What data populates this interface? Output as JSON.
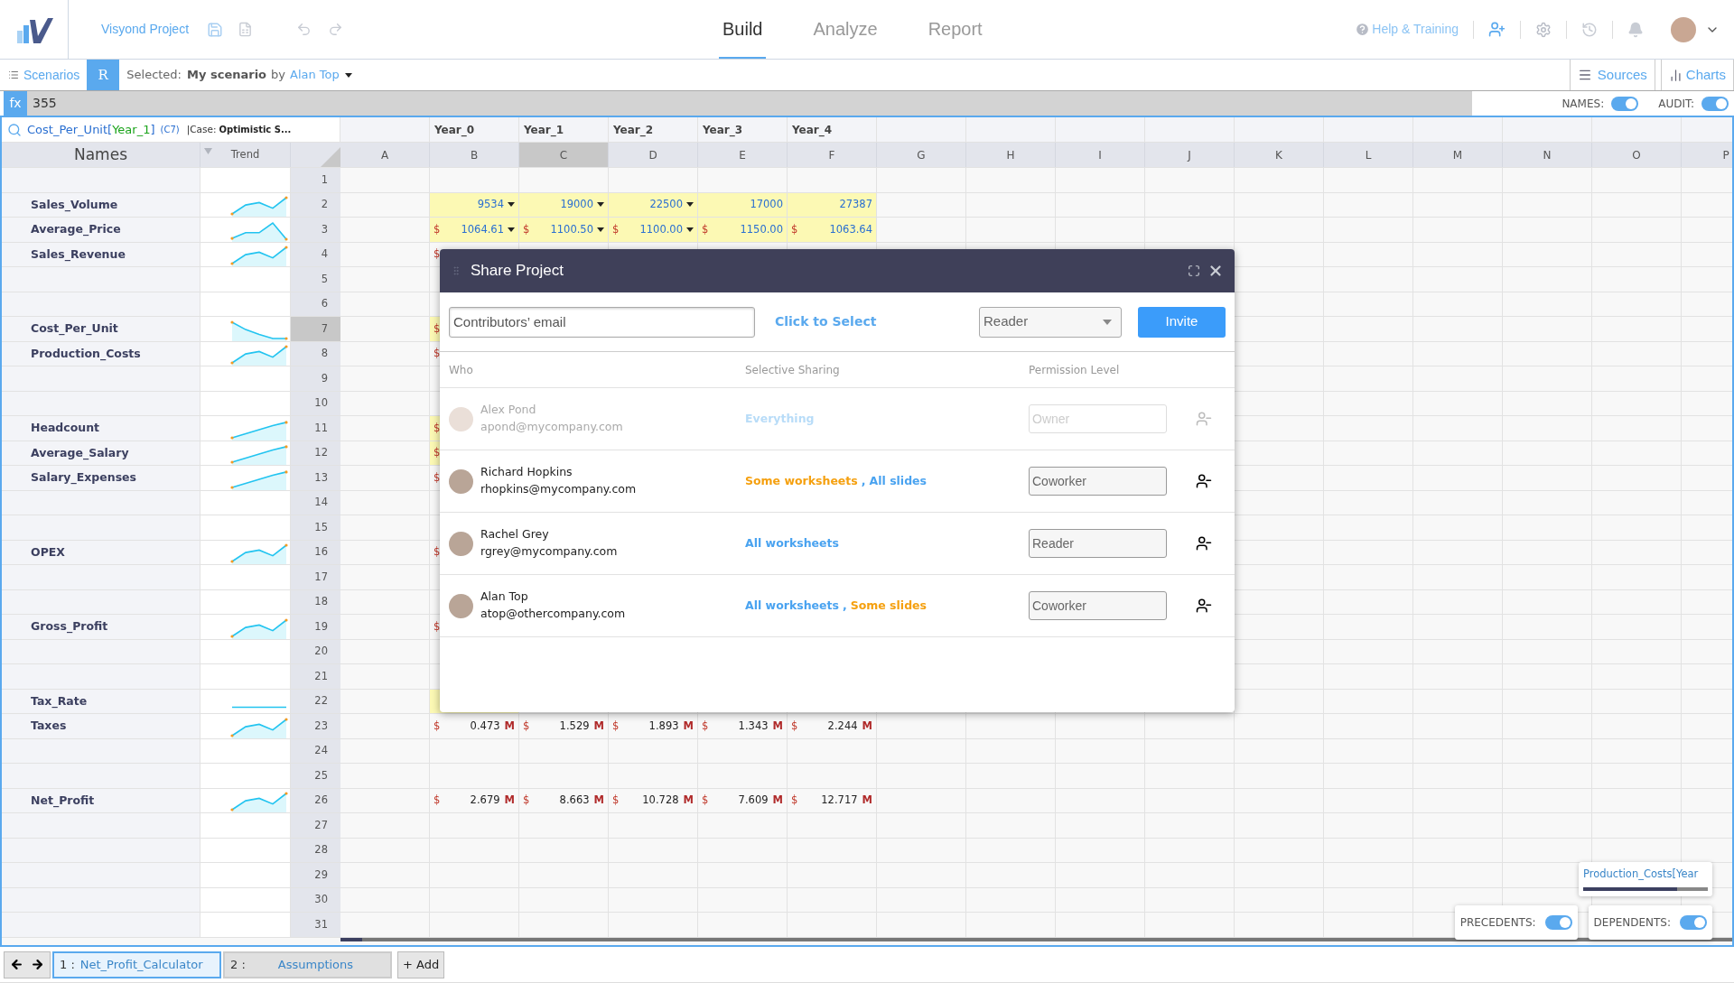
{
  "header": {
    "project": "Visyond Project",
    "tabs": [
      {
        "label": "Build",
        "selected": true
      },
      {
        "label": "Analyze",
        "selected": false
      },
      {
        "label": "Report",
        "selected": false
      }
    ],
    "help": "Help & Training"
  },
  "scenario_bar": {
    "scenarios": "Scenarios",
    "badge": "R",
    "label": "Selected:",
    "scenario": "My scenario",
    "by": "by",
    "owner": "Alan Top",
    "sources": "Sources",
    "charts": "Charts"
  },
  "formula_bar": {
    "fx": "fx",
    "value": "355",
    "toggles": [
      {
        "label": "NAMES:",
        "on": true
      },
      {
        "label": "AUDIT:",
        "on": true
      }
    ]
  },
  "name_box": {
    "parts": [
      {
        "text": "Cost_Per_Unit[",
        "kind": "name"
      },
      {
        "text": "Year_1",
        "kind": "index"
      },
      {
        "text": "]",
        "kind": "name"
      }
    ],
    "cell": "(C7)",
    "case_label": "|Case:",
    "case": "Optimistic S..."
  },
  "sheet": {
    "names_header": "Names",
    "trend_header": "Trend",
    "year_labels": [
      "Year_0",
      "Year_1",
      "Year_2",
      "Year_3",
      "Year_4"
    ],
    "columns": [
      {
        "letter": "A",
        "selected": false
      },
      {
        "letter": "B",
        "selected": false
      },
      {
        "letter": "C",
        "selected": true
      },
      {
        "letter": "D",
        "selected": false
      },
      {
        "letter": "E",
        "selected": false
      },
      {
        "letter": "F",
        "selected": false
      },
      {
        "letter": "G",
        "selected": false
      },
      {
        "letter": "H",
        "selected": false
      },
      {
        "letter": "I",
        "selected": false
      },
      {
        "letter": "J",
        "selected": false
      },
      {
        "letter": "K",
        "selected": false
      },
      {
        "letter": "L",
        "selected": false
      },
      {
        "letter": "M",
        "selected": false
      },
      {
        "letter": "N",
        "selected": false
      },
      {
        "letter": "O",
        "selected": false
      },
      {
        "letter": "P",
        "selected": false
      }
    ],
    "rows": [
      {
        "number": "1",
        "selected": false,
        "kind": "blank"
      },
      {
        "number": "2",
        "selected": false,
        "name": "Sales_Volume",
        "kind": "wave",
        "cells": [
          {
            "value": "9534",
            "input": true,
            "dropdown": true
          },
          {
            "value": "19000",
            "input": true,
            "dropdown": true
          },
          {
            "value": "22500",
            "input": true,
            "dropdown": true
          },
          {
            "value": "17000",
            "input": true,
            "dropdown": false
          },
          {
            "value": "27387",
            "input": true,
            "dropdown": false
          }
        ]
      },
      {
        "number": "3",
        "selected": false,
        "name": "Average_Price",
        "kind": "peak",
        "cells": [
          {
            "currency": "$",
            "value": "1064.61",
            "input": true,
            "dropdown": true
          },
          {
            "currency": "$",
            "value": "1100.50",
            "input": true,
            "dropdown": true
          },
          {
            "currency": "$",
            "value": "1100.00",
            "input": true,
            "dropdown": true
          },
          {
            "currency": "$",
            "value": "1150.00",
            "input": true,
            "dropdown": false
          },
          {
            "currency": "$",
            "value": "1063.64",
            "input": true,
            "dropdown": false
          }
        ]
      },
      {
        "number": "4",
        "selected": false,
        "name": "Sales_Revenue",
        "kind": "wave",
        "cells": [
          {
            "currency": "$",
            "input": false
          }
        ]
      },
      {
        "number": "5",
        "selected": false,
        "kind": "blank"
      },
      {
        "number": "6",
        "selected": false,
        "kind": "blank"
      },
      {
        "number": "7",
        "selected": true,
        "name": "Cost_Per_Unit",
        "kind": "fall",
        "cells": [
          {
            "currency": "$",
            "input": true
          }
        ]
      },
      {
        "number": "8",
        "selected": false,
        "name": "Production_Costs",
        "kind": "wave",
        "cells": [
          {
            "currency": "$",
            "input": false
          }
        ]
      },
      {
        "number": "9",
        "selected": false,
        "kind": "blank"
      },
      {
        "number": "10",
        "selected": false,
        "kind": "blank"
      },
      {
        "number": "11",
        "selected": false,
        "name": "Headcount",
        "kind": "rise",
        "cells": [
          {
            "currency": "$",
            "input": true
          }
        ]
      },
      {
        "number": "12",
        "selected": false,
        "name": "Average_Salary",
        "kind": "rise",
        "cells": [
          {
            "currency": "$",
            "input": true
          }
        ]
      },
      {
        "number": "13",
        "selected": false,
        "name": "Salary_Expenses",
        "kind": "rise",
        "cells": [
          {
            "currency": "$",
            "input": false
          }
        ]
      },
      {
        "number": "14",
        "selected": false,
        "kind": "blank"
      },
      {
        "number": "15",
        "selected": false,
        "kind": "blank"
      },
      {
        "number": "16",
        "selected": false,
        "name": "OPEX",
        "kind": "wave",
        "cells": [
          {
            "currency": "$",
            "input": false
          }
        ]
      },
      {
        "number": "17",
        "selected": false,
        "kind": "blank"
      },
      {
        "number": "18",
        "selected": false,
        "kind": "blank"
      },
      {
        "number": "19",
        "selected": false,
        "name": "Gross_Profit",
        "kind": "wave",
        "cells": [
          {
            "currency": "$",
            "input": false
          }
        ]
      },
      {
        "number": "20",
        "selected": false,
        "kind": "blank"
      },
      {
        "number": "21",
        "selected": false,
        "kind": "blank"
      },
      {
        "number": "22",
        "selected": false,
        "name": "Tax_Rate",
        "kind": "flat",
        "cells": [
          {
            "input": true
          }
        ]
      },
      {
        "number": "23",
        "selected": false,
        "name": "Taxes",
        "kind": "wave",
        "cells": [
          {
            "currency": "$",
            "value": "0.473",
            "unit": "M",
            "input": false,
            "dropdown": false
          },
          {
            "currency": "$",
            "value": "1.529",
            "unit": "M",
            "input": false,
            "dropdown": false
          },
          {
            "currency": "$",
            "value": "1.893",
            "unit": "M",
            "input": false,
            "dropdown": false
          },
          {
            "currency": "$",
            "value": "1.343",
            "unit": "M",
            "input": false,
            "dropdown": false
          },
          {
            "currency": "$",
            "value": "2.244",
            "unit": "M",
            "input": false,
            "dropdown": false
          }
        ]
      },
      {
        "number": "24",
        "selected": false,
        "kind": "blank"
      },
      {
        "number": "25",
        "selected": false,
        "kind": "blank"
      },
      {
        "number": "26",
        "selected": false,
        "name": "Net_Profit",
        "kind": "wave",
        "cells": [
          {
            "currency": "$",
            "value": "2.679",
            "unit": "M",
            "input": false,
            "dropdown": false
          },
          {
            "currency": "$",
            "value": "8.663",
            "unit": "M",
            "input": false,
            "dropdown": false
          },
          {
            "currency": "$",
            "value": "10.728",
            "unit": "M",
            "input": false,
            "dropdown": false
          },
          {
            "currency": "$",
            "value": "7.609",
            "unit": "M",
            "input": false,
            "dropdown": false
          },
          {
            "currency": "$",
            "value": "12.717",
            "unit": "M",
            "input": false,
            "dropdown": false
          }
        ]
      },
      {
        "number": "27",
        "selected": false,
        "kind": "blank"
      },
      {
        "number": "28",
        "selected": false,
        "kind": "blank"
      },
      {
        "number": "29",
        "selected": false,
        "kind": "blank"
      },
      {
        "number": "30",
        "selected": false,
        "kind": "blank"
      },
      {
        "number": "31",
        "selected": false,
        "kind": "blank"
      }
    ]
  },
  "dialog": {
    "title": "Share Project",
    "email_placeholder": "Contributors’ email",
    "select_link": "Click to Select",
    "role": "Reader",
    "invite": "Invite",
    "headers": [
      "Who",
      "Selective Sharing",
      "Permission Level"
    ],
    "members": [
      {
        "name": "Alex Pond",
        "email": "apond@mycompany.com",
        "disabled": true,
        "sharing": [
          {
            "text": "Everything",
            "kind": "full"
          }
        ],
        "permission": "Owner"
      },
      {
        "name": "Richard Hopkins",
        "email": "rhopkins@mycompany.com",
        "disabled": false,
        "sharing": [
          {
            "text": "Some worksheets",
            "kind": "partial"
          },
          {
            "text": ",",
            "kind": "separator"
          },
          {
            "text": "All slides",
            "kind": "full"
          }
        ],
        "permission": "Coworker"
      },
      {
        "name": "Rachel Grey",
        "email": "rgrey@mycompany.com",
        "disabled": false,
        "sharing": [
          {
            "text": "All worksheets",
            "kind": "full"
          }
        ],
        "permission": "Reader"
      },
      {
        "name": "Alan Top",
        "email": "atop@othercompany.com",
        "disabled": false,
        "sharing": [
          {
            "text": "All worksheets",
            "kind": "full"
          },
          {
            "text": ",",
            "kind": "separator"
          },
          {
            "text": "Some slides",
            "kind": "partial"
          }
        ],
        "permission": "Coworker"
      }
    ]
  },
  "audit": {
    "tooltip": "Production_Costs[Year",
    "level": 0.75,
    "toggles": [
      {
        "label": "PRECEDENTS:",
        "on": true
      },
      {
        "label": "DEPENDENTS:",
        "on": true
      }
    ]
  },
  "sheet_tabs": {
    "tabs": [
      {
        "index": "1 :",
        "name": "Net_Profit_Calculator",
        "selected": true
      },
      {
        "index": "2 :",
        "name": "Assumptions",
        "selected": false
      }
    ],
    "add": "+ Add"
  }
}
